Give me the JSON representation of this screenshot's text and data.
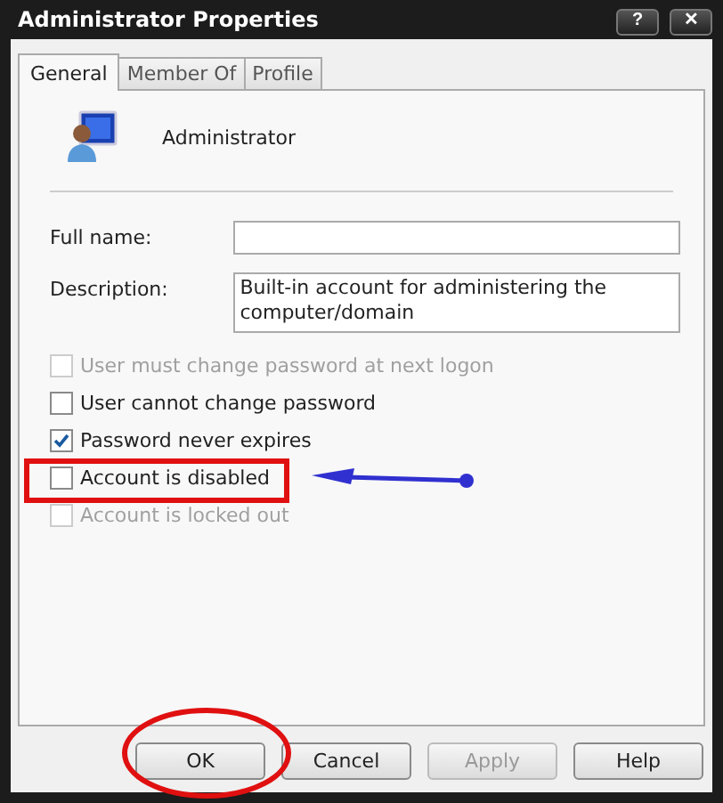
{
  "window": {
    "title": "Administrator Properties",
    "help_button": "?",
    "close_button": "✕"
  },
  "tabs": [
    {
      "label": "General",
      "selected": true
    },
    {
      "label": "Member Of",
      "selected": false
    },
    {
      "label": "Profile",
      "selected": false
    }
  ],
  "user_name": "Administrator",
  "fields": [
    {
      "label": "Full name:"
    },
    {
      "label": "Description:",
      "value": "Built-in account for administering the computer/domain"
    }
  ],
  "options": [
    {
      "label": "User must change password at next logon",
      "checked": false,
      "disabled": true
    },
    {
      "label": "User cannot change password",
      "checked": false,
      "disabled": false
    },
    {
      "label": "Password never expires",
      "checked": true,
      "disabled": false
    },
    {
      "label": "Account is disabled",
      "checked": false,
      "disabled": false
    },
    {
      "label": "Account is locked out",
      "checked": false,
      "disabled": true
    }
  ],
  "buttons": [
    {
      "label": "OK",
      "disabled": false
    },
    {
      "label": "Cancel",
      "disabled": false
    },
    {
      "label": "Apply",
      "disabled": true
    },
    {
      "label": "Help",
      "disabled": false
    }
  ]
}
